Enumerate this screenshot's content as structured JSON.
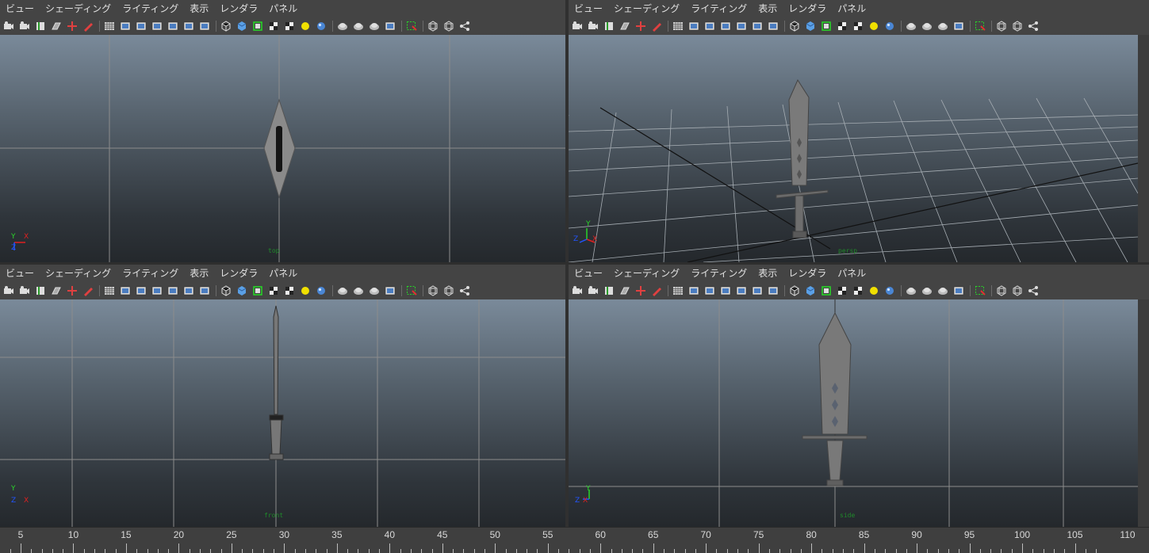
{
  "menu": [
    "ビュー",
    "シェーディング",
    "ライティング",
    "表示",
    "レンダラ",
    "パネル"
  ],
  "toolbar_icons": [
    "select-camera-icon",
    "camera-attributes-icon",
    "bookmark-icon",
    "image-plane-icon",
    "2d-pan-zoom-icon",
    "grease-pencil-icon",
    "sep",
    "grid-icon",
    "film-gate-icon",
    "resolution-gate-icon",
    "gate-mask-icon",
    "field-chart-icon",
    "safe-action-icon",
    "safe-title-icon",
    "sep",
    "wireframe-icon",
    "smooth-shade-icon",
    "wireframe-on-shaded-icon",
    "default-material-icon",
    "textured-icon",
    "use-lights-icon",
    "shadows-icon",
    "sep",
    "screen-space-ambient-occlusion-icon",
    "motion-blur-icon",
    "multisample-antialiasing-icon",
    "depth-of-field-icon",
    "sep",
    "isolate-select-icon",
    "sep",
    "x-ray-icon",
    "x-ray-active-icon",
    "x-ray-joints-icon"
  ],
  "panels": [
    {
      "id": "top",
      "camera": "top"
    },
    {
      "id": "persp",
      "camera": "persp"
    },
    {
      "id": "front",
      "camera": "front"
    },
    {
      "id": "side",
      "camera": "side"
    }
  ],
  "axes": {
    "x": "X",
    "y": "Y",
    "z": "Z"
  },
  "colors": {
    "accent_x": "#e02020",
    "accent_y": "#2ad42a",
    "accent_z": "#2255ff",
    "active_frame": "#27d327"
  },
  "timeline": {
    "labels": [
      "5",
      "10",
      "15",
      "20",
      "25",
      "30",
      "35",
      "40",
      "45",
      "50",
      "55",
      "60",
      "65",
      "70",
      "75",
      "80",
      "85",
      "90",
      "95",
      "100",
      "105",
      "110"
    ]
  }
}
